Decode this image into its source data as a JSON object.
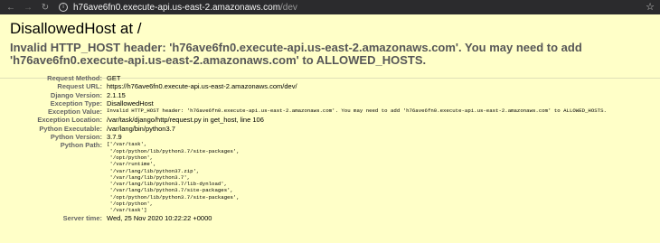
{
  "browser": {
    "url_host": "h76ave6fn0.execute-api.us-east-2.amazonaws.com",
    "url_path": "/dev"
  },
  "summary": {
    "title": "DisallowedHost at /",
    "exception_value": "Invalid HTTP_HOST header: 'h76ave6fn0.execute-api.us-east-2.amazonaws.com'. You may need to add 'h76ave6fn0.execute-api.us-east-2.amazonaws.com' to ALLOWED_HOSTS."
  },
  "meta": [
    {
      "label": "Request Method:",
      "value": "GET"
    },
    {
      "label": "Request URL:",
      "value": "https://h76ave6fn0.execute-api.us-east-2.amazonaws.com/dev/"
    },
    {
      "label": "Django Version:",
      "value": "2.1.15"
    },
    {
      "label": "Exception Type:",
      "value": "DisallowedHost"
    },
    {
      "label": "Exception Value:",
      "value": "Invalid HTTP_HOST header: 'h76ave6fn0.execute-api.us-east-2.amazonaws.com'. You may need to add 'h76ave6fn0.execute-api.us-east-2.amazonaws.com' to ALLOWED_HOSTS."
    },
    {
      "label": "Exception Location:",
      "value": "/var/task/django/http/request.py in get_host, line 106"
    },
    {
      "label": "Python Executable:",
      "value": "/var/lang/bin/python3.7"
    },
    {
      "label": "Python Version:",
      "value": "3.7.9"
    }
  ],
  "python_path": {
    "label": "Python Path:",
    "lines": [
      "['/var/task',",
      " '/opt/python/lib/python3.7/site-packages',",
      " '/opt/python',",
      " '/var/runtime',",
      " '/var/lang/lib/python37.zip',",
      " '/var/lang/lib/python3.7',",
      " '/var/lang/lib/python3.7/lib-dynload',",
      " '/var/lang/lib/python3.7/site-packages',",
      " '/opt/python/lib/python3.7/site-packages',",
      " '/opt/python',",
      " '/var/task']"
    ]
  },
  "server_time": {
    "label": "Server time:",
    "value": "Wed, 25 Nov 2020 10:22:22 +0000"
  }
}
